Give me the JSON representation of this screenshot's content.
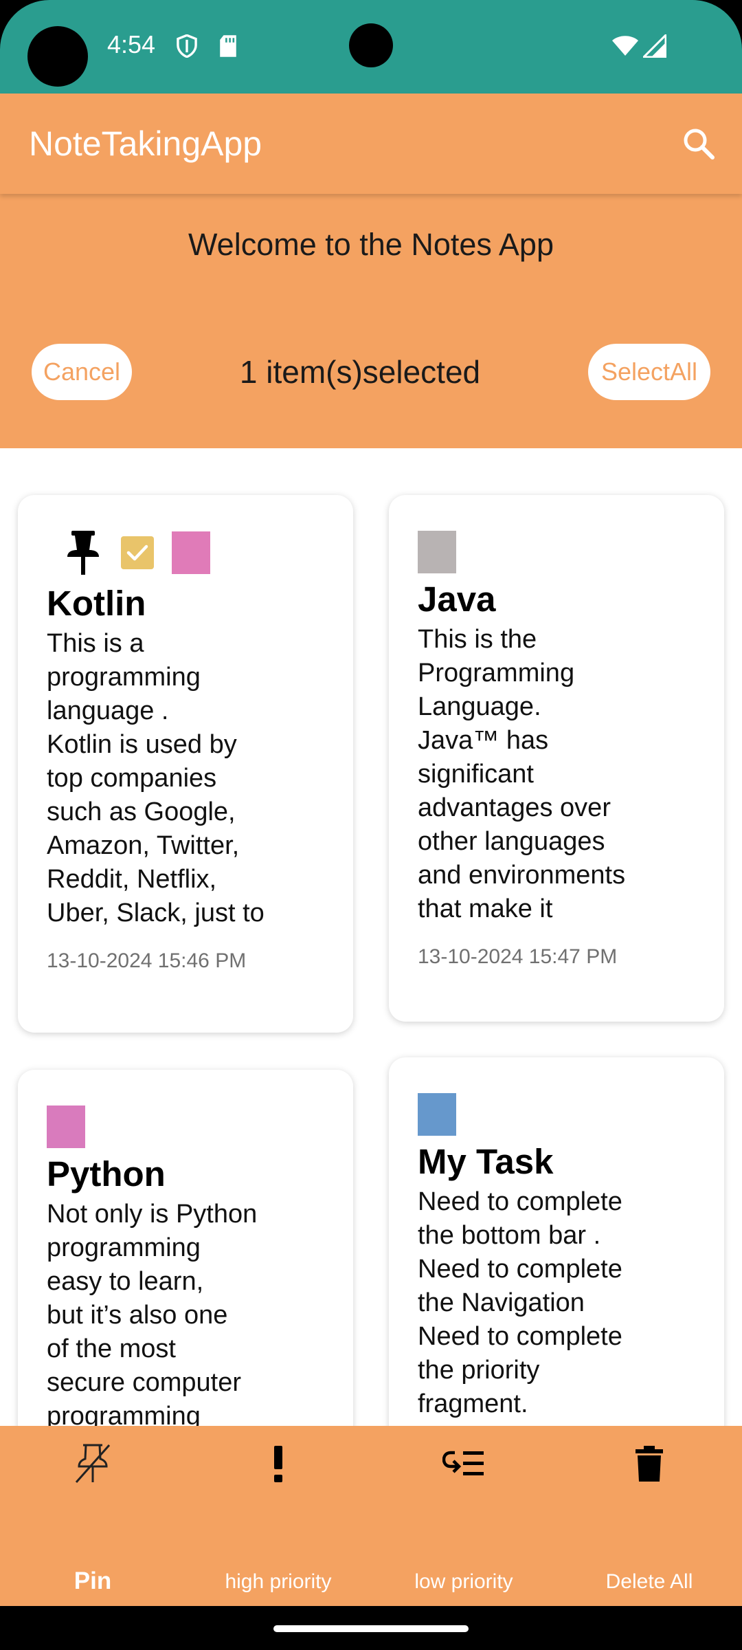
{
  "status_bar": {
    "time": "4:54",
    "icons": [
      "shield-icon",
      "sd-card-icon",
      "wifi-icon",
      "signal-icon"
    ]
  },
  "app_bar": {
    "title": "NoteTakingApp",
    "search_icon": "search-icon"
  },
  "header": {
    "welcome": "Welcome to the Notes App",
    "cancel_label": "Cancel",
    "selected_text": "1 item(s)selected",
    "select_all_label": "SelectAll"
  },
  "notes": [
    {
      "title": "Kotlin",
      "body": "This is a\nprogramming\nlanguage .\nKotlin is used by\ntop companies\nsuch as Google,\nAmazon, Twitter,\nReddit, Netflix,\nUber, Slack, just to",
      "date": "13-10-2024 15:46 PM",
      "color": "#e07bb8",
      "pinned": true,
      "selected": true
    },
    {
      "title": "Java",
      "body": "This is the\nProgramming\nLanguage.\nJava™ has\nsignificant\nadvantages over\nother languages\nand environments\nthat make it",
      "date": "13-10-2024 15:47 PM",
      "color": "#b8b3b3",
      "pinned": false,
      "selected": false
    },
    {
      "title": "Python",
      "body": "Not only is Python\nprogramming\neasy to learn,\nbut it’s also one\nof the most\nsecure computer\nprogramming",
      "date": "",
      "color": "#d97bbd",
      "pinned": false,
      "selected": false
    },
    {
      "title": "My Task",
      "body": "Need to complete\nthe bottom bar .\nNeed to complete\nthe Navigation\nNeed to complete\nthe priority\nfragment.",
      "date": "",
      "color": "#6698cc",
      "pinned": false,
      "selected": false
    }
  ],
  "bottom_nav": [
    {
      "label": "Pin",
      "icon": "unpin-icon",
      "active": true
    },
    {
      "label": "high priority",
      "icon": "exclamation-icon",
      "active": false
    },
    {
      "label": "low priority",
      "icon": "low-priority-icon",
      "active": false
    },
    {
      "label": "Delete All",
      "icon": "trash-icon",
      "active": false
    }
  ],
  "colors": {
    "status_bar": "#2a9d8f",
    "accent": "#f4a261",
    "selected_check": "#e9c46a"
  }
}
